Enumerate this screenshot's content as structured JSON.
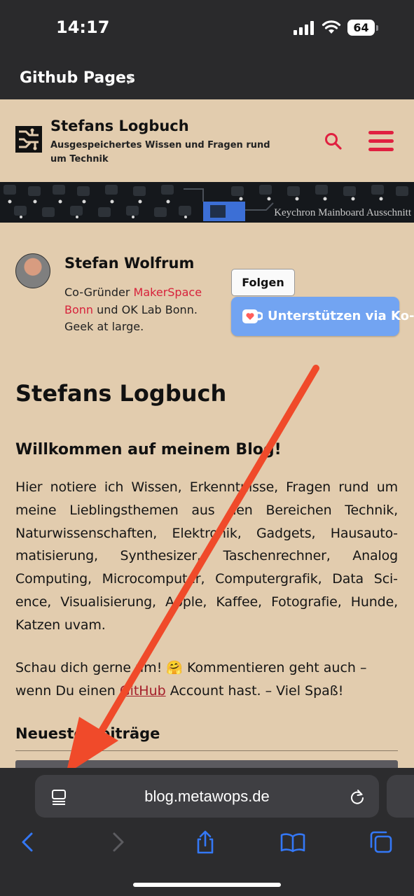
{
  "status_bar": {
    "time": "14:17",
    "battery": "64",
    "icons": [
      "signal-icon",
      "wifi-icon",
      "battery-icon"
    ]
  },
  "app_bar": {
    "back_label": "Github Pages",
    "icon": "chevron-right-icon"
  },
  "site": {
    "title": "Stefans Logbuch",
    "tagline": "Ausgespeichertes Wissen und Fragen rund um Technik",
    "accent_color": "#e02040",
    "background_color": "#e2ccae",
    "banner_caption": "Keychron Mainboard Ausschnitt"
  },
  "author": {
    "name": "Stefan Wolfrum",
    "bio_prefix": "Co-Gründer ",
    "bio_link": "MakerSpace Bonn",
    "bio_suffix": " und OK Lab Bonn. Geek at large.",
    "follow_label": "Folgen",
    "kofi_label": "Unterstützen via Ko-fi"
  },
  "content": {
    "heading": "Stefans Logbuch",
    "subheading": "Willkommen auf meinem Blog!",
    "paragraph1": "Hier notiere ich Wissen, Erkenntnisse, Fragen rund um meine Lieblingsthemen aus den Bereichen Technik, Naturwissenschaften, Elektronik, Gadgets, Hausauto­matisierung, Synthesizer, Taschenrechner, Analog Computing, Microcomputer, Computergrafik, Data Sci­ence, Visualisierung, Apple, Kaffee, Fotografie, Hunde, Katzen uvam.",
    "paragraph2_before": "Schau dich gerne um! 🤗 Kommentieren geht auch – wenn Du einen ",
    "paragraph2_link": "GitHub",
    "paragraph2_after": " Account hast. – Viel Spaß!",
    "section_title": "Neueste Beiträge"
  },
  "browser": {
    "url": "blog.metawops.de",
    "accent_color": "#3478f6",
    "toolbar": [
      "back-icon",
      "forward-icon",
      "share-icon",
      "bookmarks-icon",
      "tabs-icon"
    ]
  },
  "annotation": {
    "arrow_color": "#f04a2a"
  }
}
